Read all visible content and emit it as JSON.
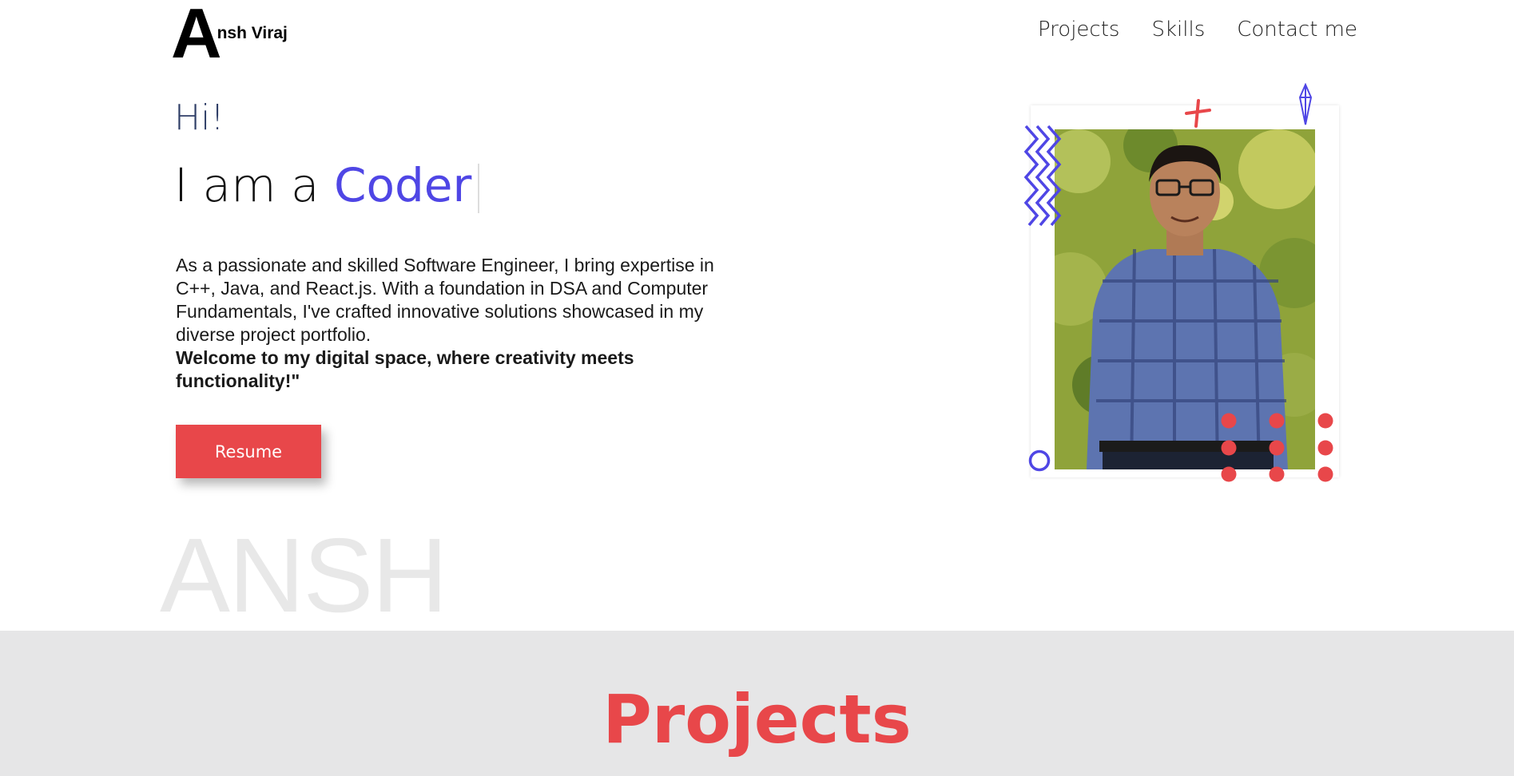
{
  "navbar": {
    "logo_letter": "A",
    "logo_text": "nsh Viraj",
    "links": [
      "Projects",
      "Skills",
      "Contact me"
    ]
  },
  "hero": {
    "greeting": "Hi!",
    "heading_prefix": "I am a ",
    "heading_role": "Coder",
    "description": "As a passionate and skilled Software Engineer, I bring expertise in C++, Java, and React.js. With a foundation in DSA and Computer Fundamentals, I've crafted innovative solutions showcased in my diverse project portfolio.",
    "welcome": "Welcome to my digital space, where creativity meets functionality!\"",
    "resume_label": "Resume",
    "watermark": "ANSH"
  },
  "projects": {
    "title": "Projects"
  },
  "colors": {
    "accent_red": "#e8474a",
    "accent_purple": "#4f46e5",
    "greeting_navy": "#2e3d66"
  },
  "icons": {
    "photo": "profile-photo",
    "zigzag": "zigzag-decoration",
    "plus": "plus-decoration",
    "crystal": "crystal-decoration",
    "ring": "ring-decoration",
    "dots": "dot-grid-decoration"
  }
}
